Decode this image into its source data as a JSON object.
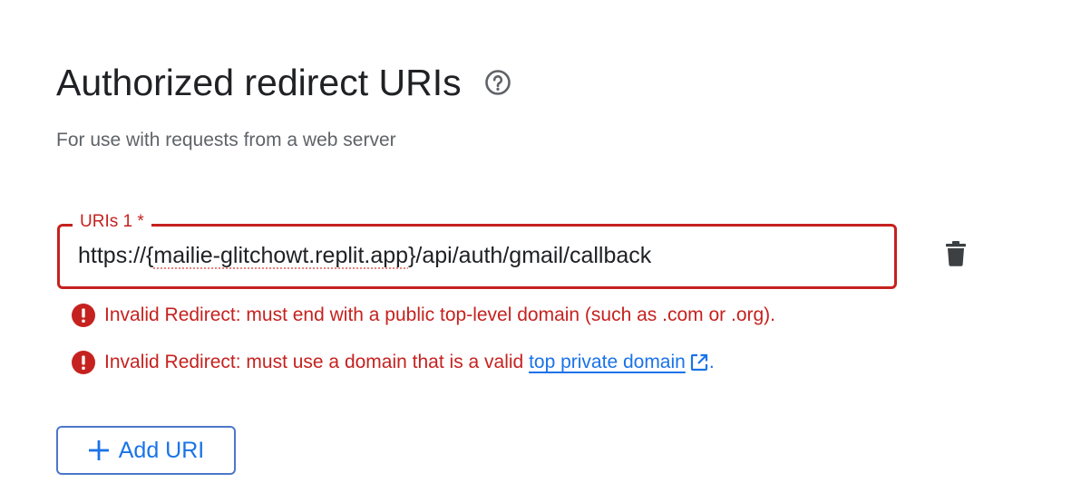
{
  "section": {
    "title": "Authorized redirect URIs",
    "subtitle": "For use with requests from a web server",
    "help_icon": "help-circle-icon"
  },
  "uri_field": {
    "label": "URIs 1 *",
    "value_prefix": "https://{",
    "value_misspelled": "mailie-glitchowt.replit.app",
    "value_suffix": "}/api/auth/gmail/callback",
    "delete_icon": "trash-icon"
  },
  "errors": {
    "first": "Invalid Redirect: must end with a public top-level domain (such as .com or .org).",
    "second_prefix": "Invalid Redirect: must use a domain that is a valid ",
    "second_link": "top private domain",
    "second_suffix": ".",
    "error_icon": "error-icon",
    "link_icon": "open-in-new-icon"
  },
  "add_button": {
    "label": "Add URI",
    "icon": "plus-icon"
  },
  "colors": {
    "error": "#c5221f",
    "link": "#1a73e8",
    "text": "#202124",
    "muted": "#5f6368"
  }
}
